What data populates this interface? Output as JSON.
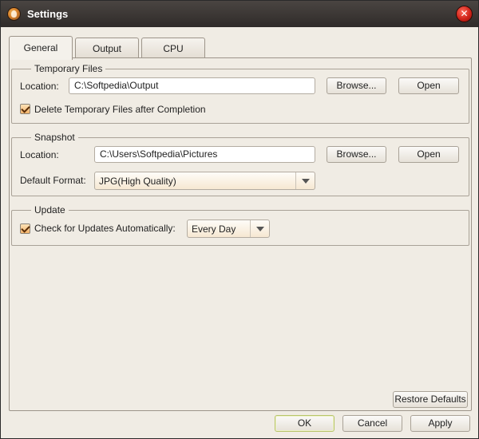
{
  "window": {
    "title": "Settings",
    "icon": "app-logo-icon",
    "close": "close-icon"
  },
  "tabs": [
    {
      "label": "General",
      "active": true
    },
    {
      "label": "Output",
      "active": false
    },
    {
      "label": "CPU",
      "active": false
    }
  ],
  "temporary_files": {
    "title": "Temporary Files",
    "location_label": "Location:",
    "location_value": "C:\\Softpedia\\Output",
    "browse_label": "Browse...",
    "open_label": "Open",
    "delete_checked": true,
    "delete_label": "Delete Temporary Files after Completion"
  },
  "snapshot": {
    "title": "Snapshot",
    "location_label": "Location:",
    "location_value": "C:\\Users\\Softpedia\\Pictures",
    "browse_label": "Browse...",
    "open_label": "Open",
    "format_label": "Default Format:",
    "format_value": "JPG(High Quality)"
  },
  "update": {
    "title": "Update",
    "check_checked": true,
    "check_label": "Check for Updates Automatically:",
    "frequency_value": "Every Day"
  },
  "footer": {
    "restore_label": "Restore Defaults",
    "ok_label": "OK",
    "cancel_label": "Cancel",
    "apply_label": "Apply"
  },
  "colors": {
    "titlebar": "#2f2b29",
    "window_bg": "#f0ece4",
    "close_button": "#d0241a",
    "checkbox_fill": "#f4b46a"
  }
}
